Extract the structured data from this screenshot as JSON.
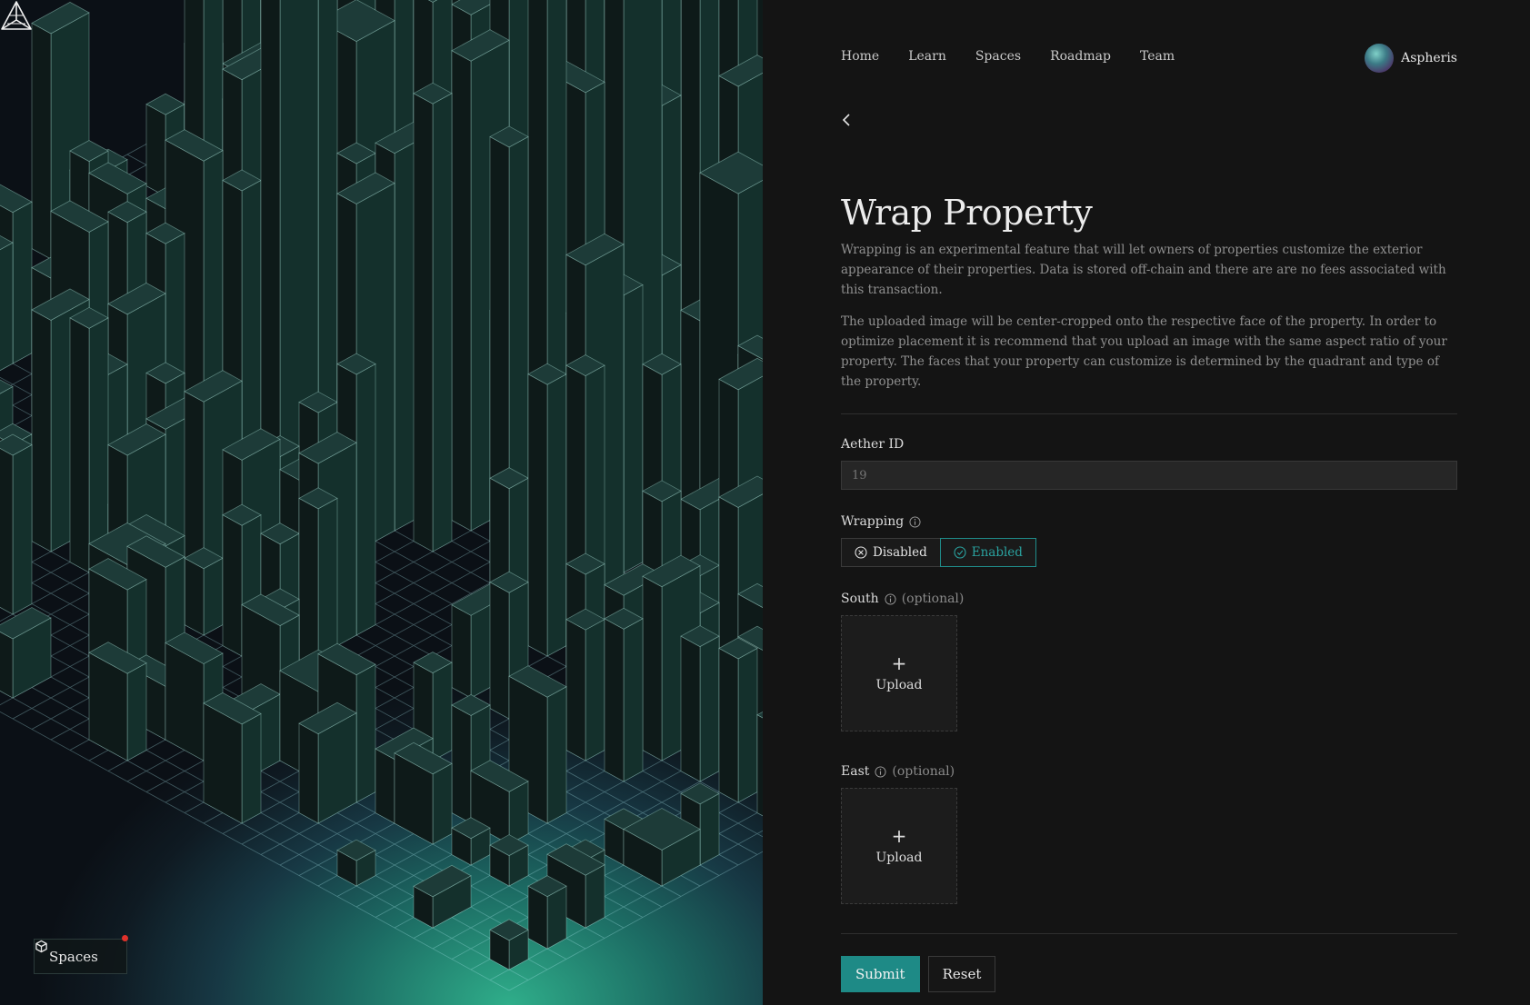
{
  "brand": {
    "logo_icon": "tetrahedron-logo-icon"
  },
  "nav": {
    "items": [
      "Home",
      "Learn",
      "Spaces",
      "Roadmap",
      "Team"
    ]
  },
  "user": {
    "name": "Aspheris"
  },
  "spaces_button": {
    "label": "Spaces",
    "icon": "cube-icon"
  },
  "form": {
    "title": "Wrap Property",
    "description_1": "Wrapping is an experimental feature that will let owners of properties customize the exterior appearance of their properties. Data is stored off-chain and there are are no fees associated with this transaction.",
    "description_2": "The uploaded image will be center-cropped onto the respective face of the property. In order to optimize placement it is recommend that you upload an image with the same aspect ratio of your property. The faces that your property can customize is determined by the quadrant and type of the property.",
    "aether_id": {
      "label": "Aether ID",
      "placeholder": "19"
    },
    "wrapping": {
      "label": "Wrapping",
      "disabled_label": "Disabled",
      "enabled_label": "Enabled",
      "selected": "Enabled"
    },
    "south": {
      "label": "South",
      "optional": "(optional)",
      "upload_label": "Upload",
      "plus": "+"
    },
    "east": {
      "label": "East",
      "optional": "(optional)",
      "upload_label": "Upload",
      "plus": "+"
    },
    "submit_label": "Submit",
    "reset_label": "Reset"
  },
  "colors": {
    "accent": "#1e8a86",
    "background": "#141414"
  }
}
